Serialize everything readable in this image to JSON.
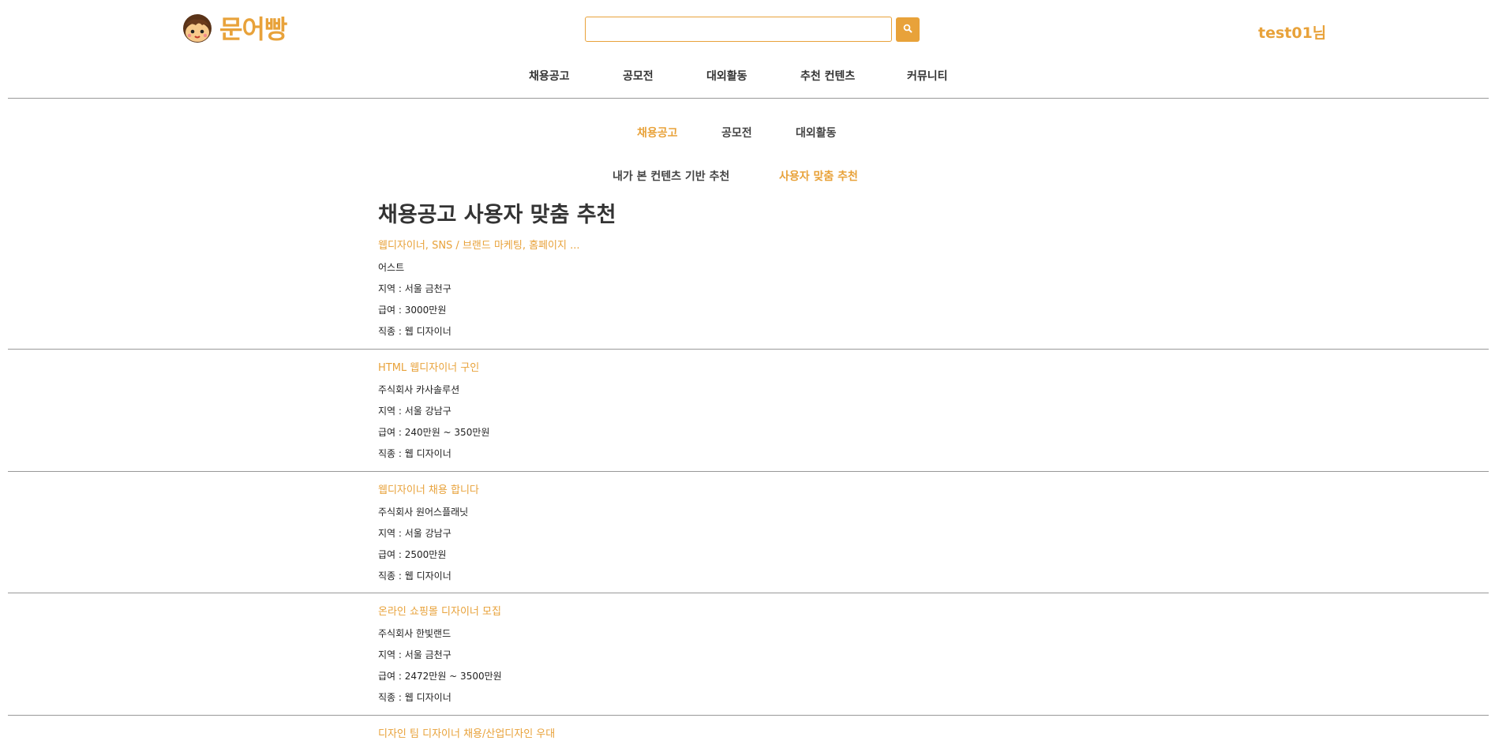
{
  "header": {
    "logo_text": "문어빵",
    "search_placeholder": "",
    "search_value": "",
    "user_label": "test01님"
  },
  "main_nav": [
    {
      "label": "채용공고"
    },
    {
      "label": "공모전"
    },
    {
      "label": "대외활동"
    },
    {
      "label": "추천 컨텐츠"
    },
    {
      "label": "커뮤니티"
    }
  ],
  "sub_tabs": [
    {
      "label": "채용공고",
      "active": true
    },
    {
      "label": "공모전",
      "active": false
    },
    {
      "label": "대외활동",
      "active": false
    }
  ],
  "rec_tabs": [
    {
      "label": "내가 본 컨텐츠 기반 추천",
      "active": false
    },
    {
      "label": "사용자 맞춤 추천",
      "active": true
    }
  ],
  "page_title": "채용공고 사용자 맞춤 추천",
  "jobs": [
    {
      "title": "웹디자이너, SNS / 브랜드 마케팅, 홈페이지 ...",
      "company": "어스트",
      "region": "지역 : 서울 금천구",
      "salary": "급여 : 3000만원",
      "job_type": "직종 : 웹 디자이너"
    },
    {
      "title": "HTML 웹디자이너 구인",
      "company": "주식회사 카사솔루션",
      "region": "지역 : 서울 강남구",
      "salary": "급여 : 240만원 ~ 350만원",
      "job_type": "직종 : 웹 디자이너"
    },
    {
      "title": "웹디자이너 채용 합니다",
      "company": "주식회사 원어스플래닛",
      "region": "지역 : 서울 강남구",
      "salary": "급여 : 2500만원",
      "job_type": "직종 : 웹 디자이너"
    },
    {
      "title": "온라인 쇼핑몰 디자이너 모집",
      "company": "주식회사 한빛랜드",
      "region": "지역 : 서울 금천구",
      "salary": "급여 : 2472만원 ~ 3500만원",
      "job_type": "직종 : 웹 디자이너"
    },
    {
      "title": "디자인 팀 디자이너 채용/산업디자인 우대"
    }
  ],
  "colors": {
    "accent": "#e8a23a",
    "divider": "#999999",
    "text": "#333333"
  },
  "icons": {
    "logo": "octopus-character-icon",
    "search": "search-icon"
  }
}
